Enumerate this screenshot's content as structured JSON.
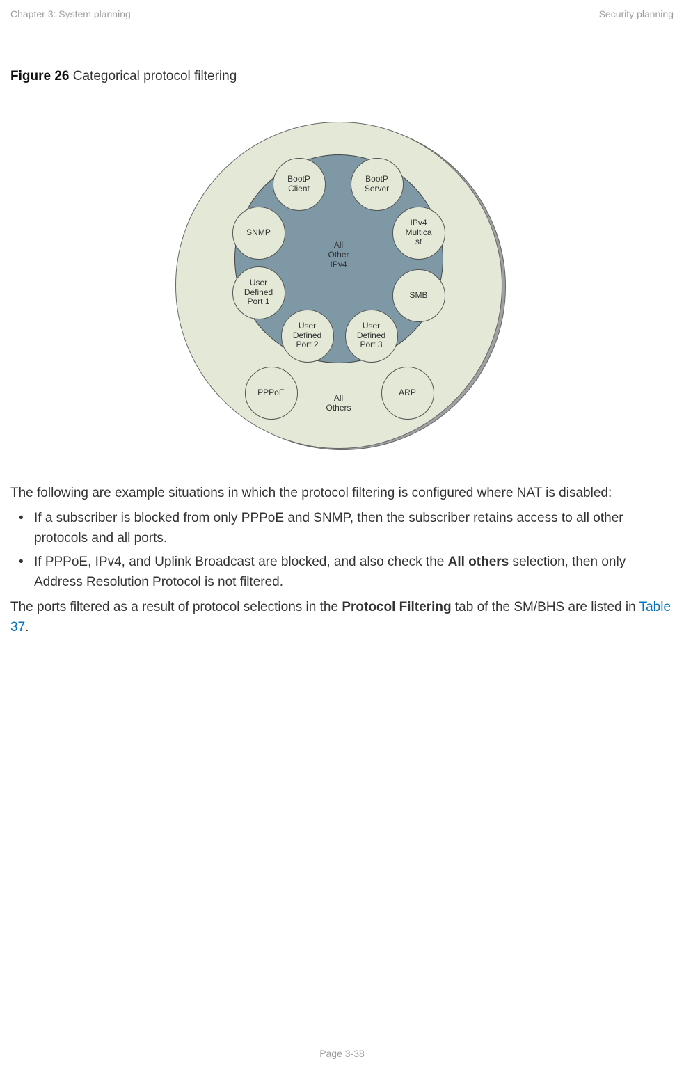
{
  "header": {
    "left": "Chapter 3:  System planning",
    "right": "Security planning"
  },
  "figure": {
    "label_bold": "Figure 26",
    "label_rest": "  Categorical protocol filtering"
  },
  "diagram": {
    "center_inner": "All\nOther\nIPv4",
    "center_outer": "All\nOthers",
    "nodes": {
      "bootp_client": "BootP\nClient",
      "bootp_server": "BootP\nServer",
      "ipv4_multicast": "IPv4\nMultica\nst",
      "smb": "SMB",
      "udp3": "User\nDefined\nPort 3",
      "udp2": "User\nDefined\nPort 2",
      "udp1": "User\nDefined\nPort 1",
      "snmp": "SNMP",
      "pppoe": "PPPoE",
      "arp": "ARP"
    }
  },
  "body": {
    "p1": "The following are example situations in which the protocol filtering is configured where NAT is disabled:",
    "li1": "If a subscriber is blocked from only PPPoE and SNMP, then the subscriber retains access to all other protocols and all ports.",
    "li2_a": "If PPPoE, IPv4, and Uplink Broadcast are blocked, and also check the ",
    "li2_bold": "All others",
    "li2_b": " selection, then only Address Resolution Protocol is not filtered.",
    "p2_a": "The ports filtered as a result of protocol selections in the ",
    "p2_bold": "Protocol Filtering",
    "p2_b": " tab of the SM/BHS are listed in ",
    "p2_link": "Table 37",
    "p2_c": "."
  },
  "footer": "Page 3-38"
}
